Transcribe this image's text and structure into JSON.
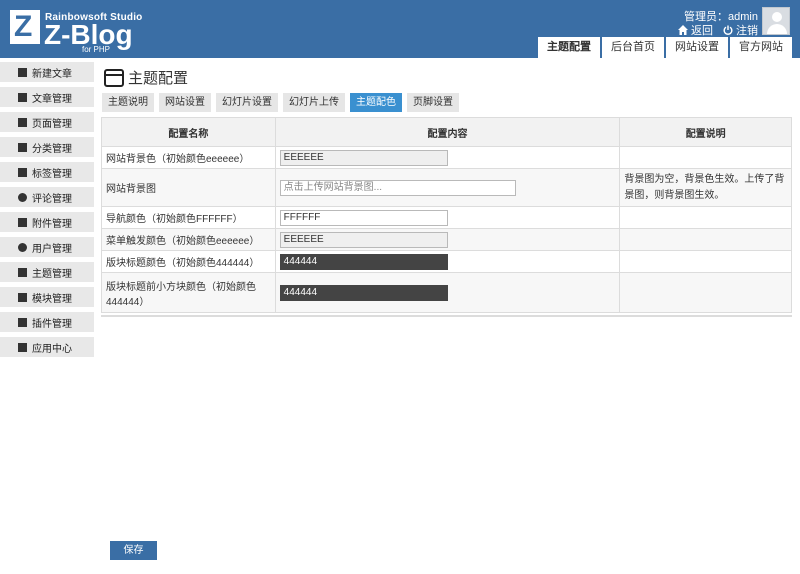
{
  "header": {
    "brand_top": "Rainbowsoft Studio",
    "brand_main": "Z-Blog",
    "brand_sub": "for PHP",
    "logo_letter": "Z",
    "admin_label": "管理员：admin",
    "back_label": "返回",
    "logout_label": "注销"
  },
  "topnav": [
    "主题配置",
    "后台首页",
    "网站设置",
    "官方网站"
  ],
  "sidebar": [
    {
      "label": "新建文章",
      "icon": "edit-icon"
    },
    {
      "label": "文章管理",
      "icon": "articles-icon"
    },
    {
      "label": "页面管理",
      "icon": "page-icon"
    },
    {
      "label": "分类管理",
      "icon": "folder-icon"
    },
    {
      "label": "标签管理",
      "icon": "tag-icon"
    },
    {
      "label": "评论管理",
      "icon": "comment-icon"
    },
    {
      "label": "附件管理",
      "icon": "attachment-icon"
    },
    {
      "label": "用户管理",
      "icon": "user-icon"
    },
    {
      "label": "主题管理",
      "icon": "theme-icon"
    },
    {
      "label": "模块管理",
      "icon": "module-icon"
    },
    {
      "label": "插件管理",
      "icon": "plugin-icon"
    },
    {
      "label": "应用中心",
      "icon": "appcenter-icon"
    }
  ],
  "page_title": "主题配置",
  "tabs": [
    {
      "label": "主题说明",
      "active": false
    },
    {
      "label": "网站设置",
      "active": false
    },
    {
      "label": "幻灯片设置",
      "active": false
    },
    {
      "label": "幻灯片上传",
      "active": false
    },
    {
      "label": "主题配色",
      "active": true
    },
    {
      "label": "页脚设置",
      "active": false
    }
  ],
  "table": {
    "headers": [
      "配置名称",
      "配置内容",
      "配置说明"
    ],
    "rows": [
      {
        "name": "网站背景色（初始颜色eeeeee）",
        "value": "EEEEEE",
        "placeholder": "",
        "style": "grey",
        "explain": ""
      },
      {
        "name": "网站背景图",
        "value": "",
        "placeholder": "点击上传网站背景图...",
        "style": "wide",
        "explain": "背景图为空，背景色生效。上传了背景图，则背景图生效。"
      },
      {
        "name": "导航颜色（初始颜色FFFFFF）",
        "value": "FFFFFF",
        "placeholder": "",
        "style": "white",
        "explain": ""
      },
      {
        "name": "菜单触发颜色（初始颜色eeeeee）",
        "value": "EEEEEE",
        "placeholder": "",
        "style": "grey",
        "explain": ""
      },
      {
        "name": "版块标题颜色（初始颜色444444）",
        "value": "444444",
        "placeholder": "",
        "style": "dark",
        "explain": ""
      },
      {
        "name": "版块标题前小方块颜色（初始颜色444444）",
        "value": "444444",
        "placeholder": "",
        "style": "dark",
        "explain": ""
      }
    ]
  },
  "save_label": "保存",
  "colors": {
    "header_bg": "#3a6ea5",
    "tab_active": "#3a90d0",
    "dark_input": "#444444"
  }
}
